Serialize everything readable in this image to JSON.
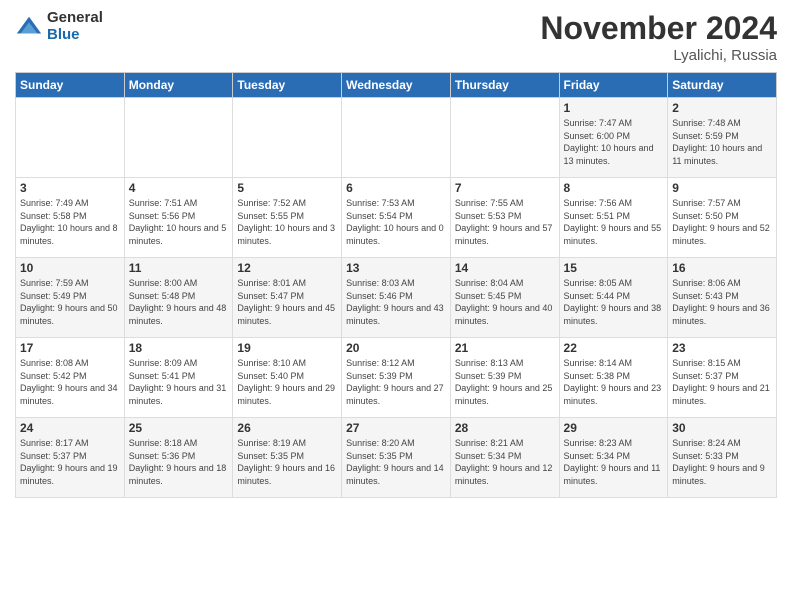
{
  "logo": {
    "general": "General",
    "blue": "Blue"
  },
  "title": "November 2024",
  "location": "Lyalichi, Russia",
  "headers": [
    "Sunday",
    "Monday",
    "Tuesday",
    "Wednesday",
    "Thursday",
    "Friday",
    "Saturday"
  ],
  "weeks": [
    [
      {
        "day": "",
        "sunrise": "",
        "sunset": "",
        "daylight": ""
      },
      {
        "day": "",
        "sunrise": "",
        "sunset": "",
        "daylight": ""
      },
      {
        "day": "",
        "sunrise": "",
        "sunset": "",
        "daylight": ""
      },
      {
        "day": "",
        "sunrise": "",
        "sunset": "",
        "daylight": ""
      },
      {
        "day": "",
        "sunrise": "",
        "sunset": "",
        "daylight": ""
      },
      {
        "day": "1",
        "sunrise": "Sunrise: 7:47 AM",
        "sunset": "Sunset: 6:00 PM",
        "daylight": "Daylight: 10 hours and 13 minutes."
      },
      {
        "day": "2",
        "sunrise": "Sunrise: 7:48 AM",
        "sunset": "Sunset: 5:59 PM",
        "daylight": "Daylight: 10 hours and 11 minutes."
      }
    ],
    [
      {
        "day": "3",
        "sunrise": "Sunrise: 7:49 AM",
        "sunset": "Sunset: 5:58 PM",
        "daylight": "Daylight: 10 hours and 8 minutes."
      },
      {
        "day": "4",
        "sunrise": "Sunrise: 7:51 AM",
        "sunset": "Sunset: 5:56 PM",
        "daylight": "Daylight: 10 hours and 5 minutes."
      },
      {
        "day": "5",
        "sunrise": "Sunrise: 7:52 AM",
        "sunset": "Sunset: 5:55 PM",
        "daylight": "Daylight: 10 hours and 3 minutes."
      },
      {
        "day": "6",
        "sunrise": "Sunrise: 7:53 AM",
        "sunset": "Sunset: 5:54 PM",
        "daylight": "Daylight: 10 hours and 0 minutes."
      },
      {
        "day": "7",
        "sunrise": "Sunrise: 7:55 AM",
        "sunset": "Sunset: 5:53 PM",
        "daylight": "Daylight: 9 hours and 57 minutes."
      },
      {
        "day": "8",
        "sunrise": "Sunrise: 7:56 AM",
        "sunset": "Sunset: 5:51 PM",
        "daylight": "Daylight: 9 hours and 55 minutes."
      },
      {
        "day": "9",
        "sunrise": "Sunrise: 7:57 AM",
        "sunset": "Sunset: 5:50 PM",
        "daylight": "Daylight: 9 hours and 52 minutes."
      }
    ],
    [
      {
        "day": "10",
        "sunrise": "Sunrise: 7:59 AM",
        "sunset": "Sunset: 5:49 PM",
        "daylight": "Daylight: 9 hours and 50 minutes."
      },
      {
        "day": "11",
        "sunrise": "Sunrise: 8:00 AM",
        "sunset": "Sunset: 5:48 PM",
        "daylight": "Daylight: 9 hours and 48 minutes."
      },
      {
        "day": "12",
        "sunrise": "Sunrise: 8:01 AM",
        "sunset": "Sunset: 5:47 PM",
        "daylight": "Daylight: 9 hours and 45 minutes."
      },
      {
        "day": "13",
        "sunrise": "Sunrise: 8:03 AM",
        "sunset": "Sunset: 5:46 PM",
        "daylight": "Daylight: 9 hours and 43 minutes."
      },
      {
        "day": "14",
        "sunrise": "Sunrise: 8:04 AM",
        "sunset": "Sunset: 5:45 PM",
        "daylight": "Daylight: 9 hours and 40 minutes."
      },
      {
        "day": "15",
        "sunrise": "Sunrise: 8:05 AM",
        "sunset": "Sunset: 5:44 PM",
        "daylight": "Daylight: 9 hours and 38 minutes."
      },
      {
        "day": "16",
        "sunrise": "Sunrise: 8:06 AM",
        "sunset": "Sunset: 5:43 PM",
        "daylight": "Daylight: 9 hours and 36 minutes."
      }
    ],
    [
      {
        "day": "17",
        "sunrise": "Sunrise: 8:08 AM",
        "sunset": "Sunset: 5:42 PM",
        "daylight": "Daylight: 9 hours and 34 minutes."
      },
      {
        "day": "18",
        "sunrise": "Sunrise: 8:09 AM",
        "sunset": "Sunset: 5:41 PM",
        "daylight": "Daylight: 9 hours and 31 minutes."
      },
      {
        "day": "19",
        "sunrise": "Sunrise: 8:10 AM",
        "sunset": "Sunset: 5:40 PM",
        "daylight": "Daylight: 9 hours and 29 minutes."
      },
      {
        "day": "20",
        "sunrise": "Sunrise: 8:12 AM",
        "sunset": "Sunset: 5:39 PM",
        "daylight": "Daylight: 9 hours and 27 minutes."
      },
      {
        "day": "21",
        "sunrise": "Sunrise: 8:13 AM",
        "sunset": "Sunset: 5:39 PM",
        "daylight": "Daylight: 9 hours and 25 minutes."
      },
      {
        "day": "22",
        "sunrise": "Sunrise: 8:14 AM",
        "sunset": "Sunset: 5:38 PM",
        "daylight": "Daylight: 9 hours and 23 minutes."
      },
      {
        "day": "23",
        "sunrise": "Sunrise: 8:15 AM",
        "sunset": "Sunset: 5:37 PM",
        "daylight": "Daylight: 9 hours and 21 minutes."
      }
    ],
    [
      {
        "day": "24",
        "sunrise": "Sunrise: 8:17 AM",
        "sunset": "Sunset: 5:37 PM",
        "daylight": "Daylight: 9 hours and 19 minutes."
      },
      {
        "day": "25",
        "sunrise": "Sunrise: 8:18 AM",
        "sunset": "Sunset: 5:36 PM",
        "daylight": "Daylight: 9 hours and 18 minutes."
      },
      {
        "day": "26",
        "sunrise": "Sunrise: 8:19 AM",
        "sunset": "Sunset: 5:35 PM",
        "daylight": "Daylight: 9 hours and 16 minutes."
      },
      {
        "day": "27",
        "sunrise": "Sunrise: 8:20 AM",
        "sunset": "Sunset: 5:35 PM",
        "daylight": "Daylight: 9 hours and 14 minutes."
      },
      {
        "day": "28",
        "sunrise": "Sunrise: 8:21 AM",
        "sunset": "Sunset: 5:34 PM",
        "daylight": "Daylight: 9 hours and 12 minutes."
      },
      {
        "day": "29",
        "sunrise": "Sunrise: 8:23 AM",
        "sunset": "Sunset: 5:34 PM",
        "daylight": "Daylight: 9 hours and 11 minutes."
      },
      {
        "day": "30",
        "sunrise": "Sunrise: 8:24 AM",
        "sunset": "Sunset: 5:33 PM",
        "daylight": "Daylight: 9 hours and 9 minutes."
      }
    ]
  ]
}
